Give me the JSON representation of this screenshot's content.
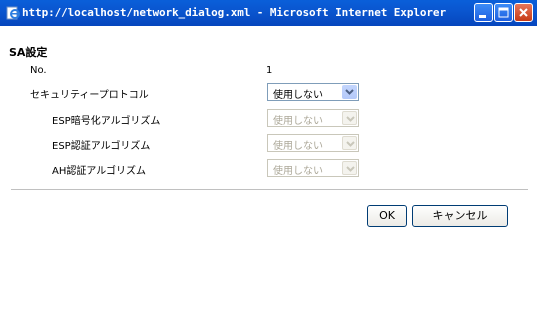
{
  "window": {
    "title": "http://localhost/network_dialog.xml - Microsoft Internet Explorer"
  },
  "section": {
    "title": "SA設定"
  },
  "fields": {
    "no": {
      "label": "No.",
      "value": "1"
    },
    "security_protocol": {
      "label": "セキュリティープロトコル",
      "value": "使用しない",
      "enabled": true
    },
    "esp_encryption": {
      "label": "ESP暗号化アルゴリズム",
      "value": "使用しない",
      "enabled": false
    },
    "esp_auth": {
      "label": "ESP認証アルゴリズム",
      "value": "使用しない",
      "enabled": false
    },
    "ah_auth": {
      "label": "AH認証アルゴリズム",
      "value": "使用しない",
      "enabled": false
    }
  },
  "buttons": {
    "ok": "OK",
    "cancel": "キャンセル"
  },
  "icons": {
    "ie": "ie-page-icon",
    "minimize": "minimize-icon",
    "maximize": "maximize-icon",
    "close": "close-icon",
    "dropdown": "chevron-down-icon"
  },
  "colors": {
    "titlebar": "#0a56d0",
    "close": "#c63a15",
    "select_arrow": "#b4c9f9"
  }
}
